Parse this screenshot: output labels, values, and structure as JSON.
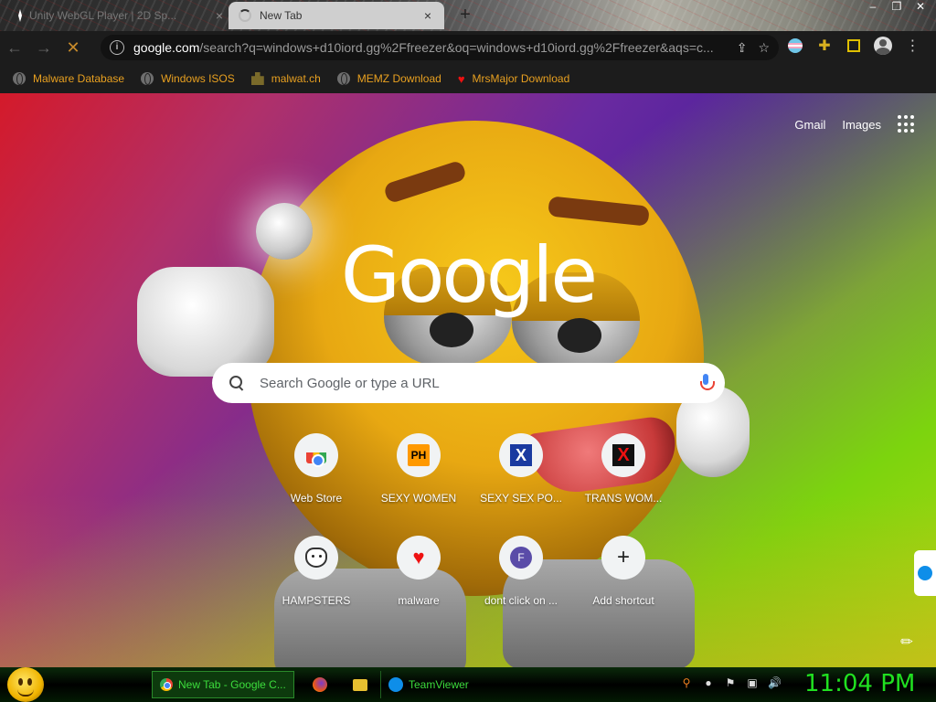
{
  "tabs": [
    {
      "title": "Unity WebGL Player | 2D Sp...",
      "close": "×"
    },
    {
      "title": "New Tab",
      "close": "×"
    }
  ],
  "new_tab_symbol": "+",
  "window_controls": {
    "minimize": "–",
    "restore": "❐",
    "close": "✕"
  },
  "toolbar": {
    "back": "←",
    "forward": "→",
    "stop": "✕",
    "url_host": "google.com",
    "url_path": "/search?q=windows+d10iord.gg%2Ffreezer&oq=windows+d10iord.gg%2Ffreezer&aqs=c...",
    "share": "⇪",
    "star": "☆",
    "puzzle": "✚",
    "menu": "⋮"
  },
  "bookmarks": [
    {
      "label": "Malware Database",
      "icon": "globe-icon"
    },
    {
      "label": "Windows ISOS",
      "icon": "globe-icon"
    },
    {
      "label": "malwat.ch",
      "icon": "robot-icon"
    },
    {
      "label": "MEMZ Download",
      "icon": "globe-icon"
    },
    {
      "label": "MrsMajor Download",
      "icon": "heart-icon"
    }
  ],
  "ntp": {
    "gmail": "Gmail",
    "images": "Images",
    "logo": "Google",
    "search_placeholder": "Search Google or type a URL",
    "shortcuts": [
      {
        "label": "Web Store",
        "icon": "webstore-icon"
      },
      {
        "label": "SEXY WOMEN",
        "icon": "ph-icon",
        "glyph": "PH"
      },
      {
        "label": "SEXY SEX PO...",
        "icon": "x-blue-icon",
        "glyph": "X"
      },
      {
        "label": "TRANS WOM...",
        "icon": "x-red-icon",
        "glyph": "X"
      },
      {
        "label": "HAMPSTERS",
        "icon": "hamster-icon"
      },
      {
        "label": "malware",
        "icon": "heart-icon",
        "glyph": "♥"
      },
      {
        "label": "dont click on ...",
        "icon": "letter-icon",
        "glyph": "F"
      },
      {
        "label": "Add shortcut",
        "icon": "plus-icon",
        "glyph": "+"
      }
    ],
    "customize_glyph": "✎"
  },
  "taskbar": {
    "chrome_label": "New Tab - Google C...",
    "teamviewer_label": "TeamViewer",
    "clock": "11:04 PM"
  },
  "colors": {
    "bookmark_text": "#e8a020",
    "clock": "#20e020",
    "tab_active_bg": "#cfcfcf"
  }
}
